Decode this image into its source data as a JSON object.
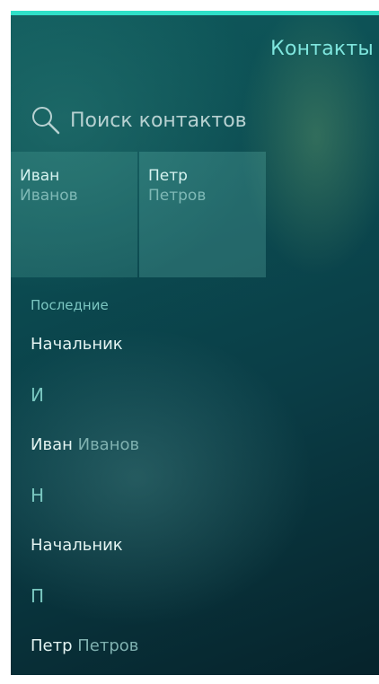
{
  "header": {
    "title": "Контакты"
  },
  "search": {
    "placeholder": "Поиск контактов",
    "icon": "search-icon"
  },
  "favorites": [
    {
      "first": "Иван",
      "last": "Иванов"
    },
    {
      "first": "Петр",
      "last": "Петров"
    }
  ],
  "recent": {
    "header": "Последние",
    "items": [
      {
        "first": "Начальник",
        "last": ""
      }
    ]
  },
  "groups": [
    {
      "letter": "И",
      "contacts": [
        {
          "first": "Иван",
          "last": "Иванов"
        }
      ]
    },
    {
      "letter": "Н",
      "contacts": [
        {
          "first": "Начальник",
          "last": ""
        }
      ]
    },
    {
      "letter": "П",
      "contacts": [
        {
          "first": "Петр",
          "last": "Петров"
        }
      ]
    }
  ],
  "colors": {
    "accent": "#2fe0c8",
    "title": "#7fe6de",
    "background_top": "#0f5a5c",
    "background_bottom": "#06232b"
  }
}
